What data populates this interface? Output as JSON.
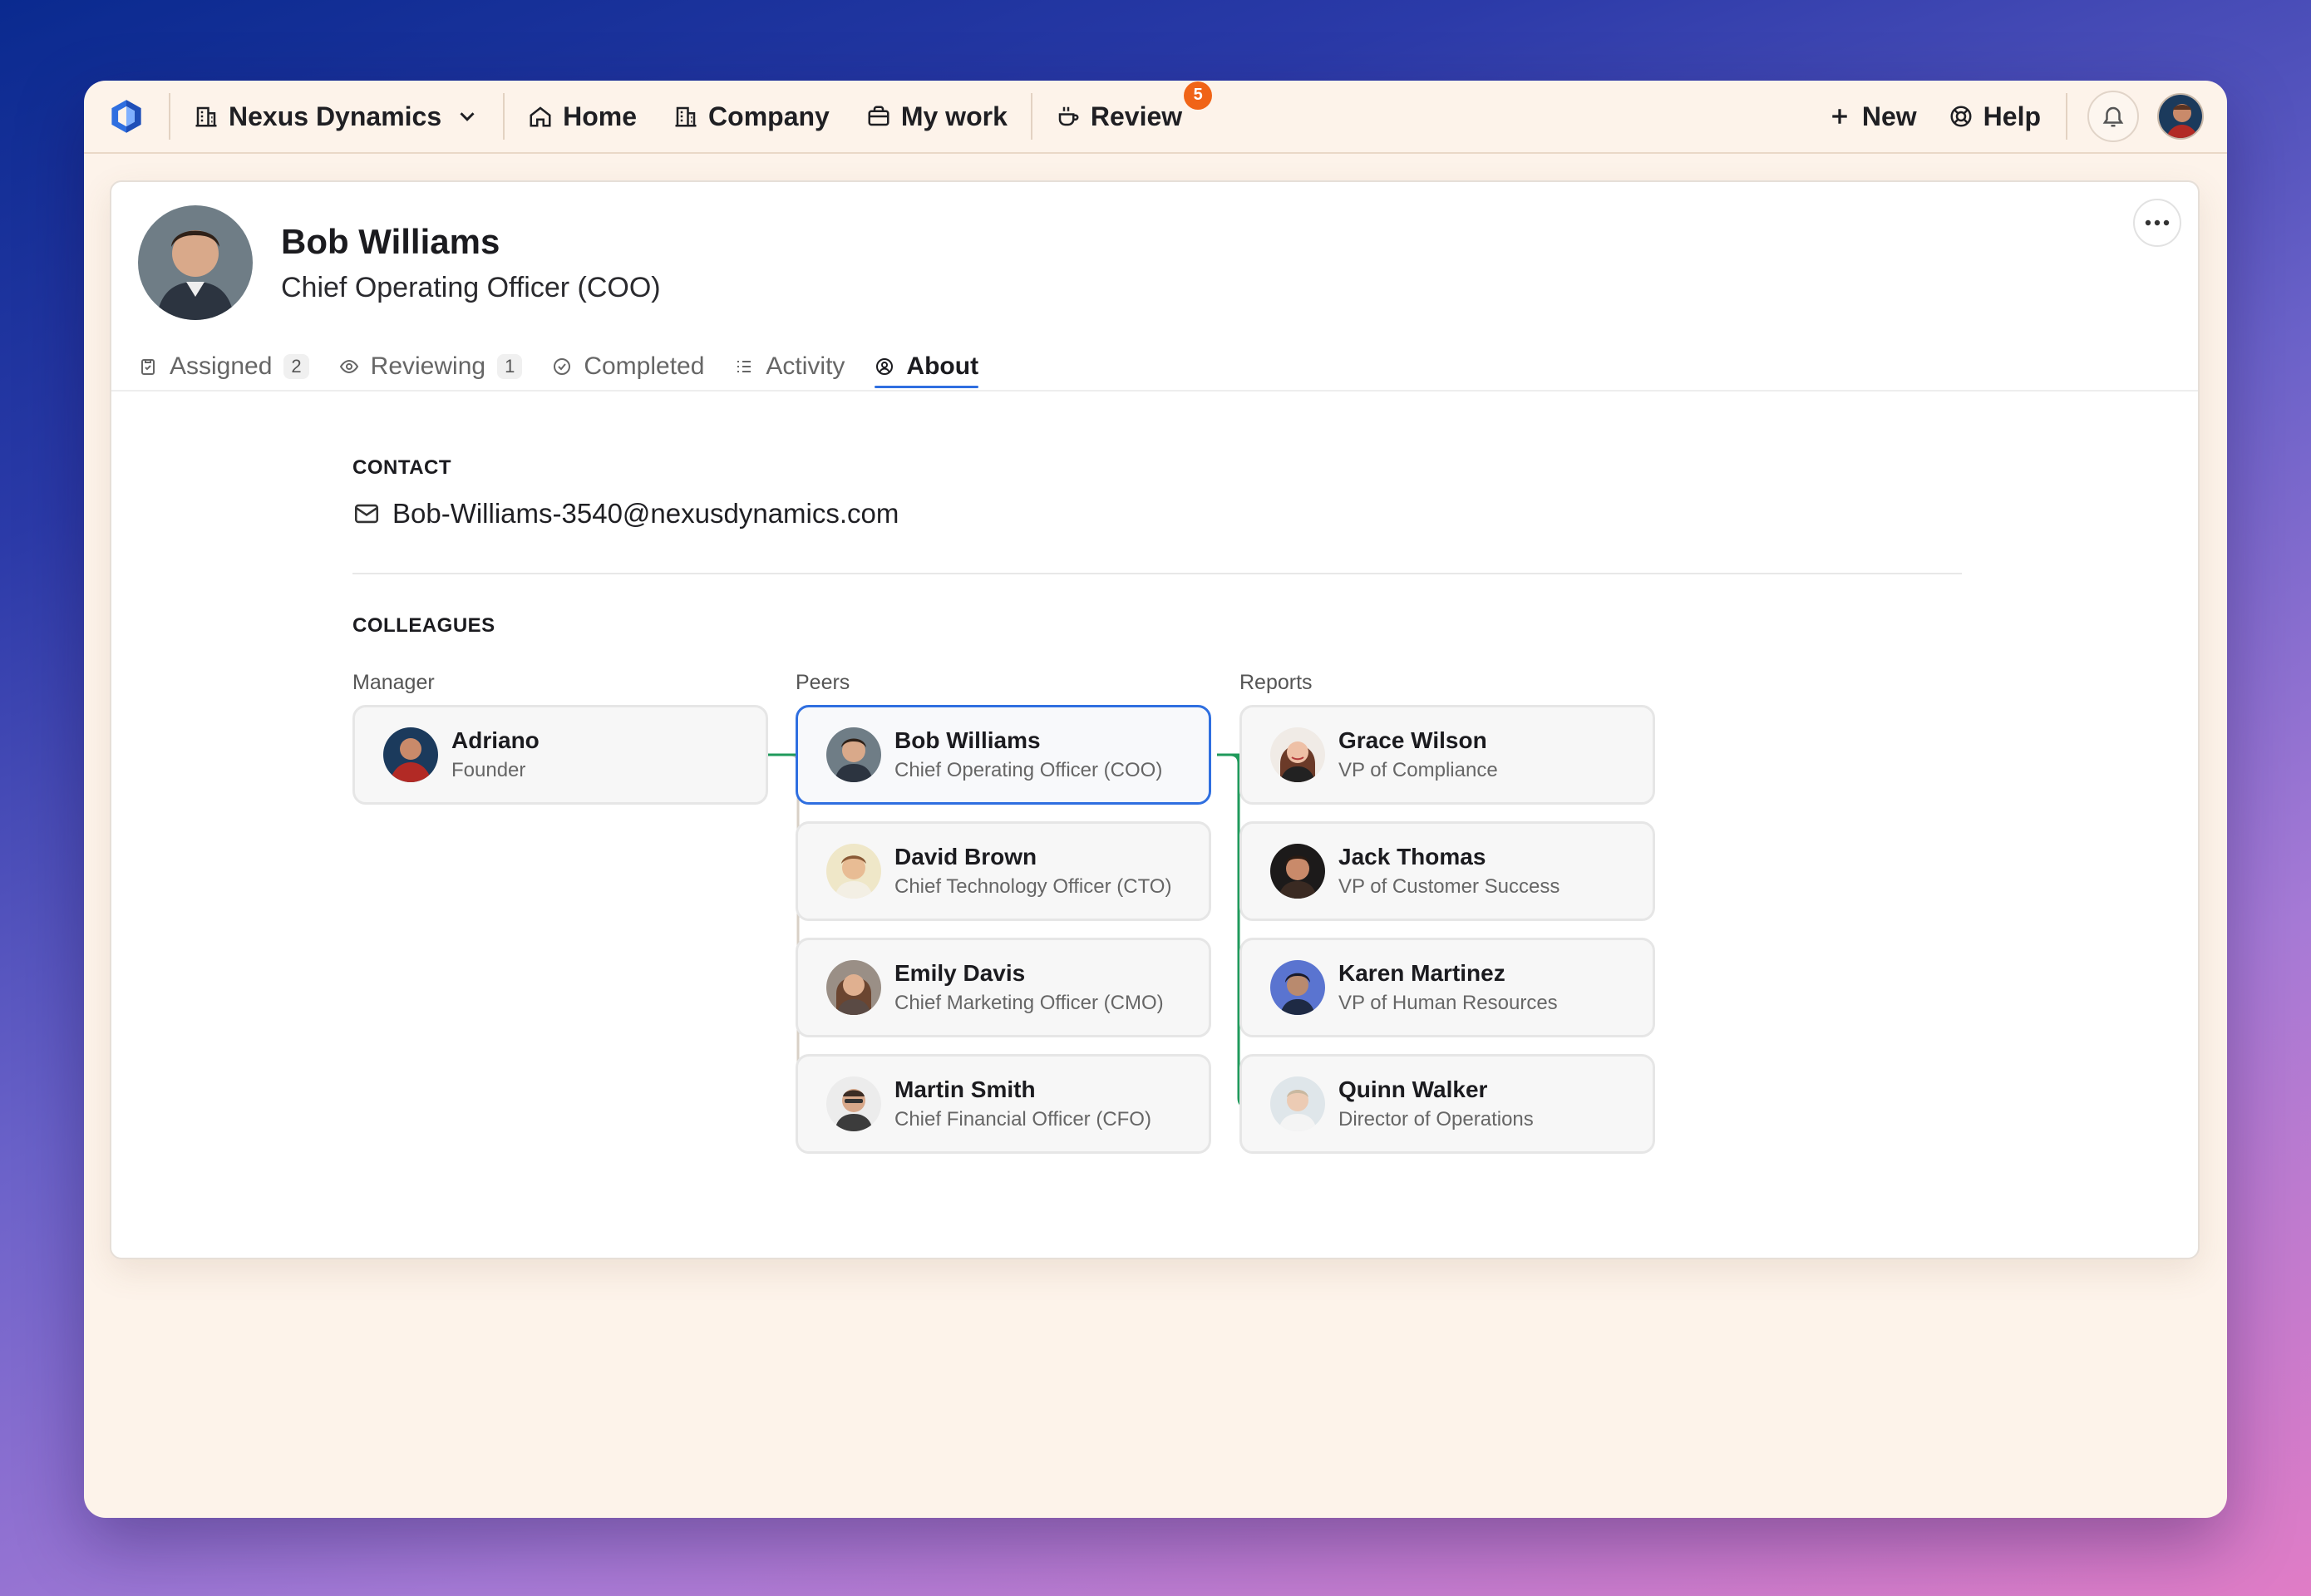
{
  "colors": {
    "accent": "#2f6fe0",
    "badge": "#f06417",
    "connector_peers": "#d8d0c6",
    "connector_reports": "#1f9a5b",
    "window_bg": "#fdf3ea"
  },
  "topbar": {
    "logo_icon": "hexagon-logo-icon",
    "org_name": "Nexus Dynamics",
    "nav": [
      {
        "label": "Home",
        "icon": "home-icon"
      },
      {
        "label": "Company",
        "icon": "building-icon"
      },
      {
        "label": "My work",
        "icon": "briefcase-icon"
      }
    ],
    "review_label": "Review",
    "review_count": "5",
    "new_label": "New",
    "help_label": "Help"
  },
  "profile": {
    "name": "Bob Williams",
    "title": "Chief Operating Officer (COO)"
  },
  "tabs": [
    {
      "label": "Assigned",
      "count": "2",
      "icon": "clipboard-icon"
    },
    {
      "label": "Reviewing",
      "count": "1",
      "icon": "eye-icon"
    },
    {
      "label": "Completed",
      "icon": "check-circle-icon"
    },
    {
      "label": "Activity",
      "icon": "list-icon"
    },
    {
      "label": "About",
      "icon": "user-circle-icon",
      "active": true
    }
  ],
  "contact": {
    "heading": "CONTACT",
    "email": "Bob-Williams-3540@nexusdynamics.com"
  },
  "colleagues": {
    "heading": "COLLEAGUES",
    "manager_label": "Manager",
    "peers_label": "Peers",
    "reports_label": "Reports",
    "manager": {
      "name": "Adriano",
      "role": "Founder"
    },
    "peers": [
      {
        "name": "Bob Williams",
        "role": "Chief Operating Officer (COO)"
      },
      {
        "name": "David Brown",
        "role": "Chief Technology Officer (CTO)"
      },
      {
        "name": "Emily Davis",
        "role": "Chief Marketing Officer (CMO)"
      },
      {
        "name": "Martin Smith",
        "role": "Chief Financial Officer (CFO)"
      }
    ],
    "reports": [
      {
        "name": "Grace Wilson",
        "role": "VP of Compliance"
      },
      {
        "name": "Jack Thomas",
        "role": "VP of Customer Success"
      },
      {
        "name": "Karen Martinez",
        "role": "VP of Human Resources"
      },
      {
        "name": "Quinn Walker",
        "role": "Director of Operations"
      }
    ]
  }
}
